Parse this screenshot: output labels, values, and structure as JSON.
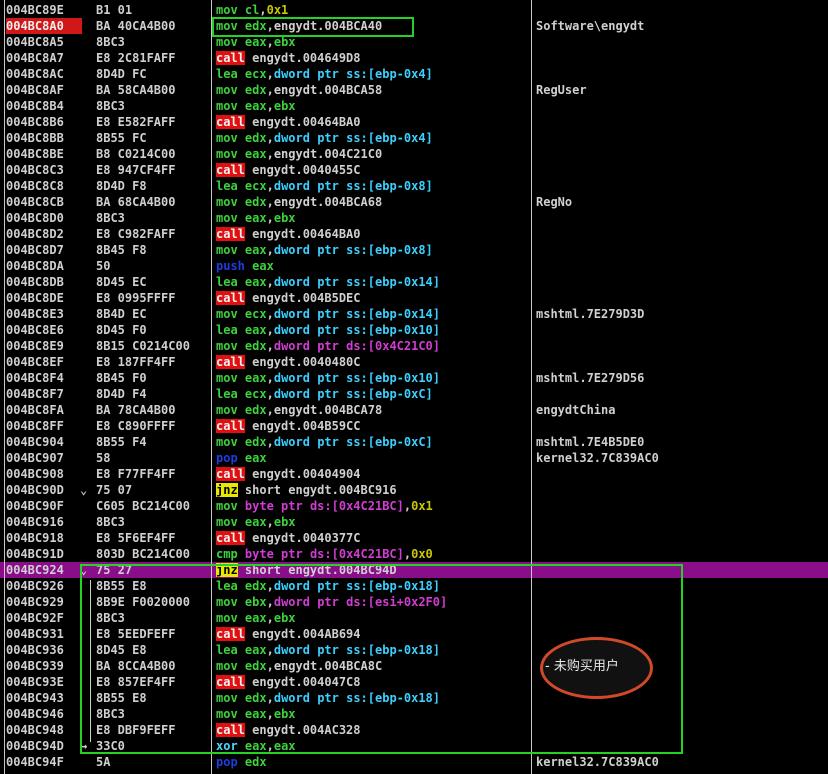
{
  "colors": {
    "background": "#000000",
    "text": "#d0d0d0",
    "register": "#3cd23c",
    "mnemonic_mov": "#3cd23c",
    "mnemonic_lea": "#3cd23c",
    "call_bg": "#e01010",
    "call_text": "#f0f0f0",
    "jnz_bg": "#e8e800",
    "jnz_text": "#000000",
    "push_pop": "#1e3ce0",
    "xor": "#4ad8ff",
    "memory_operand": "#3cd0ff",
    "memory_ds_operand": "#d23cd2",
    "immediate": "#c8c800",
    "highlight_row": "#8a0e8a",
    "selected_address": "#d01818",
    "green_box": "#22d322",
    "annotation_ring": "#d04a2a"
  },
  "annotation": {
    "label": "- 未购买用户"
  },
  "rows": [
    {
      "addr": "004BC89E",
      "hex": "B1 01",
      "dis": [
        {
          "t": "mov",
          "c": "m"
        },
        {
          "t": " "
        },
        {
          "t": "cl",
          "c": "r"
        },
        {
          "t": ","
        },
        {
          "t": "0x1",
          "c": "i"
        }
      ],
      "cmt": ""
    },
    {
      "addr": "004BC8A0",
      "hex": "BA 40CA4B00",
      "dis": [
        {
          "t": "mov",
          "c": "m"
        },
        {
          "t": " "
        },
        {
          "t": "edx",
          "c": "r"
        },
        {
          "t": ",engydt.004BCA40"
        }
      ],
      "cmt": "Software\\engydt",
      "sel": true
    },
    {
      "addr": "004BC8A5",
      "hex": "8BC3",
      "dis": [
        {
          "t": "mov",
          "c": "m"
        },
        {
          "t": " "
        },
        {
          "t": "eax",
          "c": "r"
        },
        {
          "t": ","
        },
        {
          "t": "ebx",
          "c": "r"
        }
      ],
      "cmt": ""
    },
    {
      "addr": "004BC8A7",
      "hex": "E8 2C81FAFF",
      "dis": [
        {
          "t": "call",
          "c": "call"
        },
        {
          "t": " engydt.004649D8"
        }
      ],
      "cmt": ""
    },
    {
      "addr": "004BC8AC",
      "hex": "8D4D FC",
      "dis": [
        {
          "t": "lea",
          "c": "m"
        },
        {
          "t": " "
        },
        {
          "t": "ecx",
          "c": "r"
        },
        {
          "t": ","
        },
        {
          "t": "dword ptr ss:[ebp-0x4]",
          "c": "mem"
        }
      ],
      "cmt": ""
    },
    {
      "addr": "004BC8AF",
      "hex": "BA 58CA4B00",
      "dis": [
        {
          "t": "mov",
          "c": "m"
        },
        {
          "t": " "
        },
        {
          "t": "edx",
          "c": "r"
        },
        {
          "t": ",engydt.004BCA58"
        }
      ],
      "cmt": "RegUser"
    },
    {
      "addr": "004BC8B4",
      "hex": "8BC3",
      "dis": [
        {
          "t": "mov",
          "c": "m"
        },
        {
          "t": " "
        },
        {
          "t": "eax",
          "c": "r"
        },
        {
          "t": ","
        },
        {
          "t": "ebx",
          "c": "r"
        }
      ],
      "cmt": ""
    },
    {
      "addr": "004BC8B6",
      "hex": "E8 E582FAFF",
      "dis": [
        {
          "t": "call",
          "c": "call"
        },
        {
          "t": " engydt.00464BA0"
        }
      ],
      "cmt": ""
    },
    {
      "addr": "004BC8BB",
      "hex": "8B55 FC",
      "dis": [
        {
          "t": "mov",
          "c": "m"
        },
        {
          "t": " "
        },
        {
          "t": "edx",
          "c": "r"
        },
        {
          "t": ","
        },
        {
          "t": "dword ptr ss:[ebp-0x4]",
          "c": "mem"
        }
      ],
      "cmt": ""
    },
    {
      "addr": "004BC8BE",
      "hex": "B8 C0214C00",
      "dis": [
        {
          "t": "mov",
          "c": "m"
        },
        {
          "t": " "
        },
        {
          "t": "eax",
          "c": "r"
        },
        {
          "t": ",engydt.004C21C0"
        }
      ],
      "cmt": ""
    },
    {
      "addr": "004BC8C3",
      "hex": "E8 947CF4FF",
      "dis": [
        {
          "t": "call",
          "c": "call"
        },
        {
          "t": " engydt.0040455C"
        }
      ],
      "cmt": ""
    },
    {
      "addr": "004BC8C8",
      "hex": "8D4D F8",
      "dis": [
        {
          "t": "lea",
          "c": "m"
        },
        {
          "t": " "
        },
        {
          "t": "ecx",
          "c": "r"
        },
        {
          "t": ","
        },
        {
          "t": "dword ptr ss:[ebp-0x8]",
          "c": "mem"
        }
      ],
      "cmt": ""
    },
    {
      "addr": "004BC8CB",
      "hex": "BA 68CA4B00",
      "dis": [
        {
          "t": "mov",
          "c": "m"
        },
        {
          "t": " "
        },
        {
          "t": "edx",
          "c": "r"
        },
        {
          "t": ",engydt.004BCA68"
        }
      ],
      "cmt": "RegNo"
    },
    {
      "addr": "004BC8D0",
      "hex": "8BC3",
      "dis": [
        {
          "t": "mov",
          "c": "m"
        },
        {
          "t": " "
        },
        {
          "t": "eax",
          "c": "r"
        },
        {
          "t": ","
        },
        {
          "t": "ebx",
          "c": "r"
        }
      ],
      "cmt": ""
    },
    {
      "addr": "004BC8D2",
      "hex": "E8 C982FAFF",
      "dis": [
        {
          "t": "call",
          "c": "call"
        },
        {
          "t": " engydt.00464BA0"
        }
      ],
      "cmt": ""
    },
    {
      "addr": "004BC8D7",
      "hex": "8B45 F8",
      "dis": [
        {
          "t": "mov",
          "c": "m"
        },
        {
          "t": " "
        },
        {
          "t": "eax",
          "c": "r"
        },
        {
          "t": ","
        },
        {
          "t": "dword ptr ss:[ebp-0x8]",
          "c": "mem"
        }
      ],
      "cmt": ""
    },
    {
      "addr": "004BC8DA",
      "hex": "50",
      "dis": [
        {
          "t": "push",
          "c": "pp"
        },
        {
          "t": " "
        },
        {
          "t": "eax",
          "c": "r"
        }
      ],
      "cmt": ""
    },
    {
      "addr": "004BC8DB",
      "hex": "8D45 EC",
      "dis": [
        {
          "t": "lea",
          "c": "m"
        },
        {
          "t": " "
        },
        {
          "t": "eax",
          "c": "r"
        },
        {
          "t": ","
        },
        {
          "t": "dword ptr ss:[ebp-0x14]",
          "c": "mem"
        }
      ],
      "cmt": ""
    },
    {
      "addr": "004BC8DE",
      "hex": "E8 0995FFFF",
      "dis": [
        {
          "t": "call",
          "c": "call"
        },
        {
          "t": " engydt.004B5DEC"
        }
      ],
      "cmt": ""
    },
    {
      "addr": "004BC8E3",
      "hex": "8B4D EC",
      "dis": [
        {
          "t": "mov",
          "c": "m"
        },
        {
          "t": " "
        },
        {
          "t": "ecx",
          "c": "r"
        },
        {
          "t": ","
        },
        {
          "t": "dword ptr ss:[ebp-0x14]",
          "c": "mem"
        }
      ],
      "cmt": "mshtml.7E279D3D"
    },
    {
      "addr": "004BC8E6",
      "hex": "8D45 F0",
      "dis": [
        {
          "t": "lea",
          "c": "m"
        },
        {
          "t": " "
        },
        {
          "t": "eax",
          "c": "r"
        },
        {
          "t": ","
        },
        {
          "t": "dword ptr ss:[ebp-0x10]",
          "c": "mem"
        }
      ],
      "cmt": ""
    },
    {
      "addr": "004BC8E9",
      "hex": "8B15 C0214C00",
      "dis": [
        {
          "t": "mov",
          "c": "m"
        },
        {
          "t": " "
        },
        {
          "t": "edx",
          "c": "r"
        },
        {
          "t": ","
        },
        {
          "t": "dword ptr ds:[0x4C21C0]",
          "c": "ds"
        }
      ],
      "cmt": ""
    },
    {
      "addr": "004BC8EF",
      "hex": "E8 187FF4FF",
      "dis": [
        {
          "t": "call",
          "c": "call"
        },
        {
          "t": " engydt.0040480C"
        }
      ],
      "cmt": ""
    },
    {
      "addr": "004BC8F4",
      "hex": "8B45 F0",
      "dis": [
        {
          "t": "mov",
          "c": "m"
        },
        {
          "t": " "
        },
        {
          "t": "eax",
          "c": "r"
        },
        {
          "t": ","
        },
        {
          "t": "dword ptr ss:[ebp-0x10]",
          "c": "mem"
        }
      ],
      "cmt": "mshtml.7E279D56"
    },
    {
      "addr": "004BC8F7",
      "hex": "8D4D F4",
      "dis": [
        {
          "t": "lea",
          "c": "m"
        },
        {
          "t": " "
        },
        {
          "t": "ecx",
          "c": "r"
        },
        {
          "t": ","
        },
        {
          "t": "dword ptr ss:[ebp-0xC]",
          "c": "mem"
        }
      ],
      "cmt": ""
    },
    {
      "addr": "004BC8FA",
      "hex": "BA 78CA4B00",
      "dis": [
        {
          "t": "mov",
          "c": "m"
        },
        {
          "t": " "
        },
        {
          "t": "edx",
          "c": "r"
        },
        {
          "t": ",engydt.004BCA78"
        }
      ],
      "cmt": "engydtChina"
    },
    {
      "addr": "004BC8FF",
      "hex": "E8 C890FFFF",
      "dis": [
        {
          "t": "call",
          "c": "call"
        },
        {
          "t": " engydt.004B59CC"
        }
      ],
      "cmt": ""
    },
    {
      "addr": "004BC904",
      "hex": "8B55 F4",
      "dis": [
        {
          "t": "mov",
          "c": "m"
        },
        {
          "t": " "
        },
        {
          "t": "edx",
          "c": "r"
        },
        {
          "t": ","
        },
        {
          "t": "dword ptr ss:[ebp-0xC]",
          "c": "mem"
        }
      ],
      "cmt": "mshtml.7E4B5DE0"
    },
    {
      "addr": "004BC907",
      "hex": "58",
      "dis": [
        {
          "t": "pop",
          "c": "pp"
        },
        {
          "t": " "
        },
        {
          "t": "eax",
          "c": "r"
        }
      ],
      "cmt": "kernel32.7C839AC0"
    },
    {
      "addr": "004BC908",
      "hex": "E8 F77FF4FF",
      "dis": [
        {
          "t": "call",
          "c": "call"
        },
        {
          "t": " engydt.00404904"
        }
      ],
      "cmt": ""
    },
    {
      "addr": "004BC90D",
      "hex": "75 07",
      "arrow": "⌄",
      "dis": [
        {
          "t": "jnz",
          "c": "jnz"
        },
        {
          "t": " short engydt.004BC916"
        }
      ],
      "cmt": ""
    },
    {
      "addr": "004BC90F",
      "hex": "C605 BC214C00",
      "dis": [
        {
          "t": "mov",
          "c": "m"
        },
        {
          "t": " "
        },
        {
          "t": "byte ptr ds:[0x4C21BC]",
          "c": "ds"
        },
        {
          "t": ","
        },
        {
          "t": "0x1",
          "c": "i"
        }
      ],
      "cmt": ""
    },
    {
      "addr": "004BC916",
      "hex": "8BC3",
      "dis": [
        {
          "t": "mov",
          "c": "m"
        },
        {
          "t": " "
        },
        {
          "t": "eax",
          "c": "r"
        },
        {
          "t": ","
        },
        {
          "t": "ebx",
          "c": "r"
        }
      ],
      "cmt": ""
    },
    {
      "addr": "004BC918",
      "hex": "E8 5F6EF4FF",
      "dis": [
        {
          "t": "call",
          "c": "call"
        },
        {
          "t": " engydt.0040377C"
        }
      ],
      "cmt": ""
    },
    {
      "addr": "004BC91D",
      "hex": "803D BC214C00",
      "dis": [
        {
          "t": "cmp",
          "c": "m"
        },
        {
          "t": " "
        },
        {
          "t": "byte ptr ds:[0x4C21BC]",
          "c": "ds"
        },
        {
          "t": ","
        },
        {
          "t": "0x0",
          "c": "i"
        }
      ],
      "cmt": ""
    },
    {
      "addr": "004BC924",
      "hex": "75 27",
      "arrow": "⌄",
      "dis": [
        {
          "t": "jnz",
          "c": "jnz"
        },
        {
          "t": " short engydt.004BC94D"
        }
      ],
      "cmt": "",
      "hl": true
    },
    {
      "addr": "004BC926",
      "hex": "8B55 E8",
      "dis": [
        {
          "t": "lea",
          "c": "m"
        },
        {
          "t": " "
        },
        {
          "t": "edx",
          "c": "r"
        },
        {
          "t": ","
        },
        {
          "t": "dword ptr ss:[ebp-0x18]",
          "c": "mem"
        }
      ],
      "cmt": ""
    },
    {
      "addr": "004BC929",
      "hex": "8B9E F0020000",
      "dis": [
        {
          "t": "mov",
          "c": "m"
        },
        {
          "t": " "
        },
        {
          "t": "ebx",
          "c": "r"
        },
        {
          "t": ","
        },
        {
          "t": "dword ptr ds:[esi+0x2F0]",
          "c": "ds"
        }
      ],
      "cmt": ""
    },
    {
      "addr": "004BC92F",
      "hex": "8BC3",
      "dis": [
        {
          "t": "mov",
          "c": "m"
        },
        {
          "t": " "
        },
        {
          "t": "eax",
          "c": "r"
        },
        {
          "t": ","
        },
        {
          "t": "ebx",
          "c": "r"
        }
      ],
      "cmt": ""
    },
    {
      "addr": "004BC931",
      "hex": "E8 5EEDFEFF",
      "dis": [
        {
          "t": "call",
          "c": "call"
        },
        {
          "t": " engydt.004AB694"
        }
      ],
      "cmt": ""
    },
    {
      "addr": "004BC936",
      "hex": "8D45 E8",
      "dis": [
        {
          "t": "lea",
          "c": "m"
        },
        {
          "t": " "
        },
        {
          "t": "eax",
          "c": "r"
        },
        {
          "t": ","
        },
        {
          "t": "dword ptr ss:[ebp-0x18]",
          "c": "mem"
        }
      ],
      "cmt": ""
    },
    {
      "addr": "004BC939",
      "hex": "BA 8CCA4B00",
      "dis": [
        {
          "t": "mov",
          "c": "m"
        },
        {
          "t": " "
        },
        {
          "t": "edx",
          "c": "r"
        },
        {
          "t": ",engydt.004BCA8C"
        }
      ],
      "cmt": ""
    },
    {
      "addr": "004BC93E",
      "hex": "E8 857EF4FF",
      "dis": [
        {
          "t": "call",
          "c": "call"
        },
        {
          "t": " engydt.004047C8"
        }
      ],
      "cmt": ""
    },
    {
      "addr": "004BC943",
      "hex": "8B55 E8",
      "dis": [
        {
          "t": "mov",
          "c": "m"
        },
        {
          "t": " "
        },
        {
          "t": "edx",
          "c": "r"
        },
        {
          "t": ","
        },
        {
          "t": "dword ptr ss:[ebp-0x18]",
          "c": "mem"
        }
      ],
      "cmt": ""
    },
    {
      "addr": "004BC946",
      "hex": "8BC3",
      "dis": [
        {
          "t": "mov",
          "c": "m"
        },
        {
          "t": " "
        },
        {
          "t": "eax",
          "c": "r"
        },
        {
          "t": ","
        },
        {
          "t": "ebx",
          "c": "r"
        }
      ],
      "cmt": ""
    },
    {
      "addr": "004BC948",
      "hex": "E8 DBF9FEFF",
      "dis": [
        {
          "t": "call",
          "c": "call"
        },
        {
          "t": " engydt.004AC328"
        }
      ],
      "cmt": ""
    },
    {
      "addr": "004BC94D",
      "hex": "33C0",
      "arrow": "→",
      "dis": [
        {
          "t": "xor",
          "c": "x"
        },
        {
          "t": " "
        },
        {
          "t": "eax",
          "c": "r"
        },
        {
          "t": ","
        },
        {
          "t": "eax",
          "c": "r"
        }
      ],
      "cmt": ""
    },
    {
      "addr": "004BC94F",
      "hex": "5A",
      "dis": [
        {
          "t": "pop",
          "c": "pp"
        },
        {
          "t": " "
        },
        {
          "t": "edx",
          "c": "r"
        }
      ],
      "cmt": "kernel32.7C839AC0"
    }
  ]
}
